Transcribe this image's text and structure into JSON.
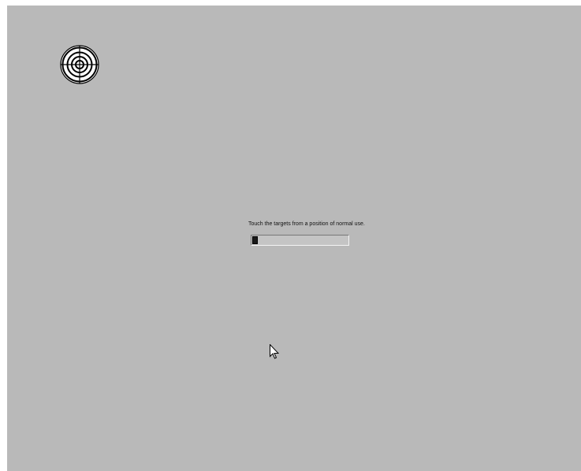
{
  "calibration": {
    "instruction": "Touch the targets from a position of normal use.",
    "progress_fraction": 0.06
  },
  "icons": {
    "target": "crosshair-target-icon",
    "cursor": "mouse-pointer-icon"
  },
  "colors": {
    "background": "#b9b9b9",
    "progress_fill": "#1a1a1a"
  }
}
